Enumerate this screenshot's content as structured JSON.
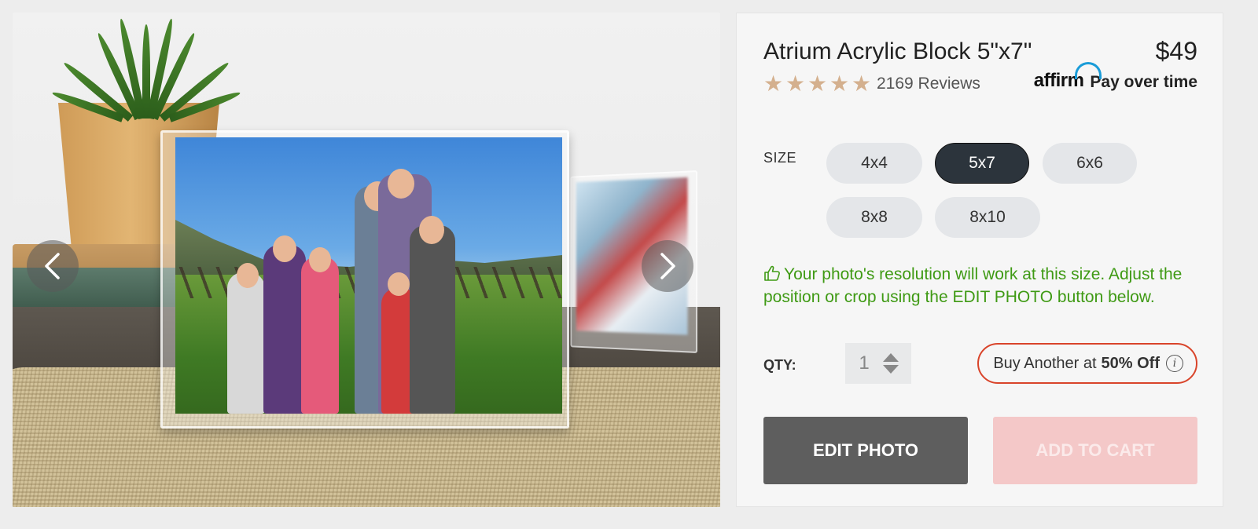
{
  "product": {
    "title": "Atrium Acrylic Block 5\"x7\"",
    "price": "$49",
    "rating": 5,
    "reviews": "2169 Reviews",
    "affirm_logo": "affirm",
    "affirm_text": "Pay over time"
  },
  "size": {
    "label": "SIZE",
    "options": [
      "4x4",
      "5x7",
      "6x6",
      "8x8",
      "8x10"
    ],
    "selected": "5x7"
  },
  "resolution_message": "Your photo's resolution will work at this size. Adjust the position or crop using the EDIT PHOTO button below.",
  "qty": {
    "label": "QTY:",
    "value": "1"
  },
  "buy_another": {
    "prefix": "Buy Another at",
    "discount": "50% Off"
  },
  "buttons": {
    "edit_photo": "EDIT PHOTO",
    "add_to_cart": "ADD TO CART"
  },
  "colors": {
    "success": "#3f9a14",
    "selected_size": "#2c343c",
    "buy_another_border": "#d9442a",
    "edit_button": "#5e5e5e",
    "cart_button_disabled": "#f4c8c8",
    "star": "#d4b08e",
    "affirm_blue": "#1a9cd8"
  },
  "icons": {
    "prev": "chevron-left-icon",
    "next": "chevron-right-icon",
    "thumbs_up": "thumbs-up-icon",
    "info": "info-icon",
    "star": "star-icon"
  }
}
